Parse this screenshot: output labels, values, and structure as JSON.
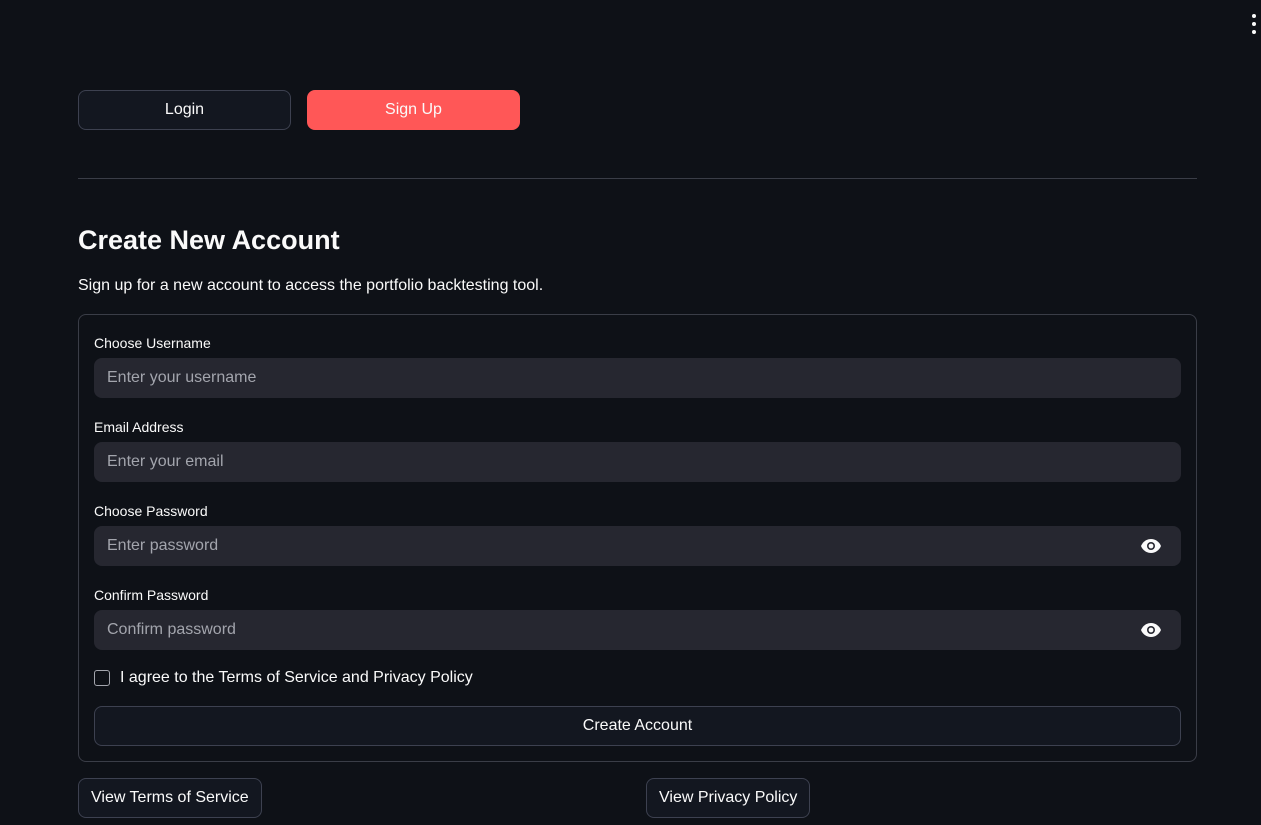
{
  "tabs": {
    "login_label": "Login",
    "signup_label": "Sign Up"
  },
  "header": {
    "title": "Create New Account",
    "subtitle": "Sign up for a new account to access the portfolio backtesting tool."
  },
  "form": {
    "username": {
      "label": "Choose Username",
      "placeholder": "Enter your username",
      "value": ""
    },
    "email": {
      "label": "Email Address",
      "placeholder": "Enter your email",
      "value": ""
    },
    "password": {
      "label": "Choose Password",
      "placeholder": "Enter password",
      "value": ""
    },
    "confirm_password": {
      "label": "Confirm Password",
      "placeholder": "Confirm password",
      "value": ""
    },
    "agree_label": "I agree to the Terms of Service and Privacy Policy",
    "agree_checked": false,
    "submit_label": "Create Account"
  },
  "footer": {
    "terms_label": "View Terms of Service",
    "privacy_label": "View Privacy Policy"
  },
  "icons": {
    "menu": "kebab-menu-icon",
    "show_password": "eye-icon"
  },
  "colors": {
    "background": "#0e1117",
    "accent": "#ff5757",
    "input_background": "#262730",
    "border": "#3a3d47"
  }
}
